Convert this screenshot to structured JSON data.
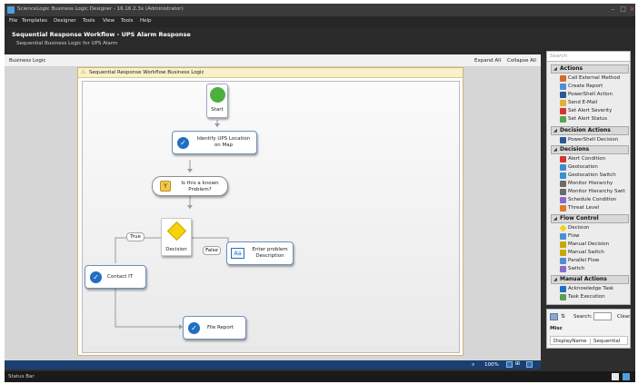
{
  "window": {
    "title": "ScienceLogic Business Logic Designer - 16.16.2.3x (Administrator)"
  },
  "menu": [
    "File",
    "Templates",
    "Designer",
    "Tools",
    "View",
    "Tools",
    "Help"
  ],
  "header": {
    "title": "Sequential Response Workflow - UPS Alarm Response",
    "subtitle": "Sequential Business Logic for UPS Alarm"
  },
  "toolbar": {
    "section_label": "Business Logic",
    "expand_all": "Expand All",
    "collapse_all": "Collapse All"
  },
  "workflow": {
    "title": "Sequential Response Workflow Business Logic",
    "nodes": {
      "start": "Start",
      "identify": "Identify UPS Location on Map",
      "known_problem": "Is this a known Problem?",
      "decision": "Decision",
      "contact": "Contact IT",
      "enter_problem": "Enter problem Description",
      "file_report": "File Report"
    },
    "branches": {
      "true_label": "True",
      "false_label": "False"
    },
    "input_icon_text": "Aa"
  },
  "status": {
    "zoom": "100%",
    "status_bar_text": "Status Bar"
  },
  "palette": {
    "search_placeholder": "Search",
    "categories": [
      {
        "title": "Actions",
        "items": [
          "Call External Method",
          "Create Report",
          "PowerShell Action",
          "Send E-Mail",
          "Set Alert Severity",
          "Set Alert Status"
        ]
      },
      {
        "title": "Decision Actions",
        "items": [
          "PowerShell Decision"
        ]
      },
      {
        "title": "Decisions",
        "items": [
          "Alert Condition",
          "Geolocation",
          "Geolocation Switch",
          "Monitor Hierarchy",
          "Monitor Hierarchy Swit",
          "Schedule Condition",
          "Threat Level"
        ]
      },
      {
        "title": "Flow Control",
        "items": [
          "Decision",
          "Flow",
          "Manual Decision",
          "Manual Switch",
          "Parallel Flow",
          "Switch"
        ]
      },
      {
        "title": "Manual Actions",
        "items": [
          "Acknowledge Task",
          "Task Execution"
        ]
      }
    ]
  },
  "properties": {
    "search_label": "Search:",
    "clear_label": "Clear",
    "misc_label": "Misc",
    "rows": [
      {
        "key": "DisplayName",
        "value": "Sequential"
      }
    ]
  },
  "colors": {
    "accent_blue": "#1f6fc2",
    "start_green": "#4caf3f",
    "decision_yellow": "#f5d20a",
    "header_bg": "#2a2a2a",
    "palette_bg": "#ececec"
  }
}
